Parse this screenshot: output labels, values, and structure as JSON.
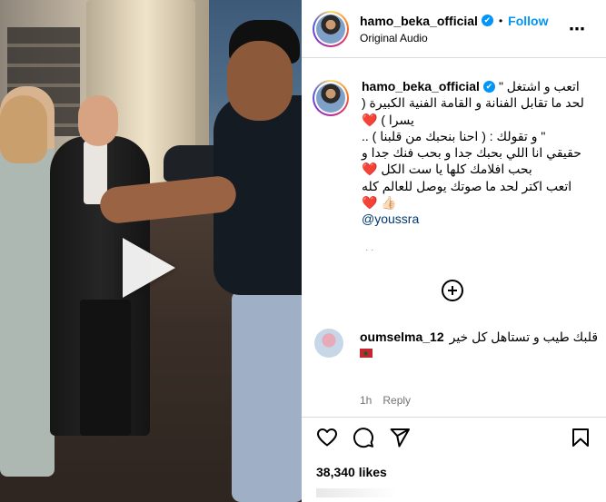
{
  "post": {
    "username": "hamo_beka_official",
    "verified": "✔",
    "follow_label": "Follow",
    "separator": "•",
    "audio": "Original Audio",
    "more_icon": "more-horizontal-icon"
  },
  "caption": {
    "username": "hamo_beka_official",
    "lines": [
      "اتعب و اشتغل \"",
      "لحد ما تقابل الفنانة و القامة الفنية الكبيرة (",
      "يسرا ) ❤️",
      "\" و تقولك : ( احنا بنحبك من قلبنا ) ..",
      "حقيقي انا اللي بحبك جدا و بحب فنك جدا و",
      "بحب افلامك كلها يا ست الكل ❤️",
      "اتعب اكتر لحد ما صوتك يوصل للعالم كله",
      "❤️ 👍🏻"
    ],
    "mention": "@youssra"
  },
  "comment": {
    "username": "oumselma_12",
    "text": "قلبك طيب و تستاهل كل خير",
    "time": "1h",
    "reply_label": "Reply"
  },
  "likes": "38,340 likes",
  "colors": {
    "accent": "#0095f6",
    "mention": "#00376b",
    "border": "#dbdbdb",
    "muted": "#737373"
  }
}
